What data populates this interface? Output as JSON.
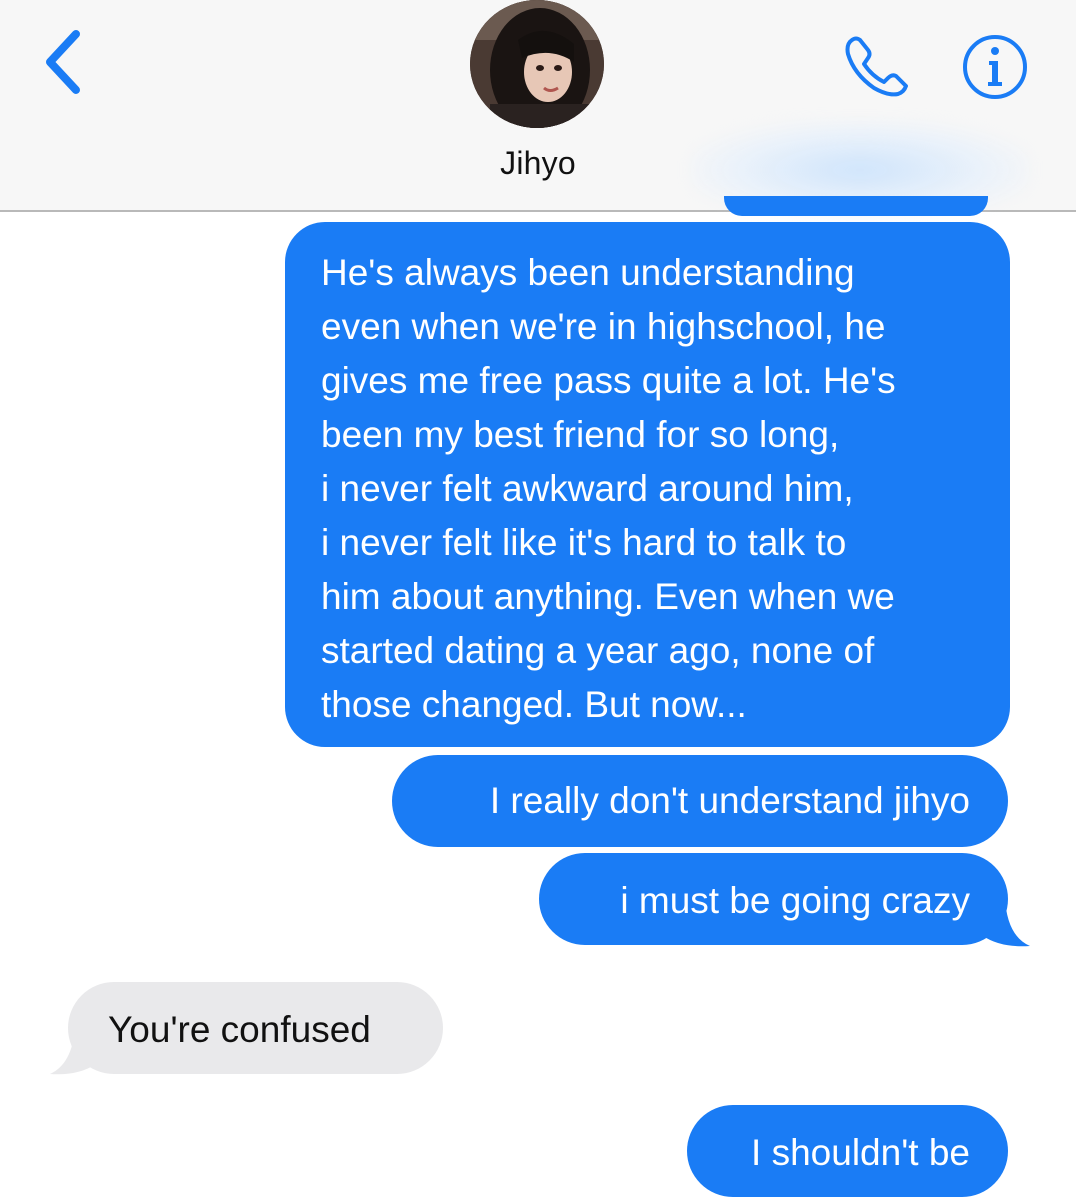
{
  "header": {
    "contact_name": "Jihyo",
    "icons": {
      "back": "chevron-left-icon",
      "phone": "phone-icon",
      "info": "info-icon"
    },
    "accent_color": "#1a7cf5"
  },
  "messages": [
    {
      "direction": "sent",
      "lines": [
        "He's always been understanding",
        "even when we're in highschool, he",
        "gives me free pass quite a lot. He's",
        "been my best friend for so long,",
        "i never felt awkward around him,",
        "i never felt like it's hard to talk to",
        "him about anything. Even when we",
        "started dating a year ago, none of",
        "those changed. But now..."
      ]
    },
    {
      "direction": "sent",
      "text": "I really don't understand jihyo"
    },
    {
      "direction": "sent",
      "text": "i must be going crazy"
    },
    {
      "direction": "received",
      "text": "You're confused"
    },
    {
      "direction": "sent",
      "text": "I shouldn't be"
    }
  ],
  "colors": {
    "sent_bubble": "#1a7cf5",
    "received_bubble": "#e9e9eb",
    "header_bg": "#f7f7f7"
  }
}
